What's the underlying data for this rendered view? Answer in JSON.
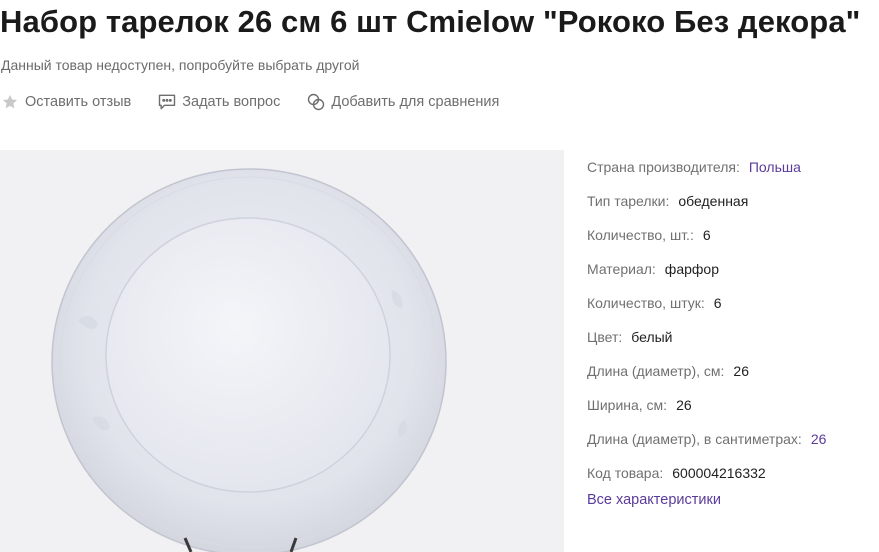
{
  "product": {
    "title": "Набор тарелок 26 см 6 шт Cmielow \"Рококо Без декора\"",
    "availability": "Данный товар недоступен, попробуйте выбрать другой"
  },
  "actions": {
    "review": {
      "label": "Оставить отзыв",
      "icon": "star-icon"
    },
    "question": {
      "label": "Задать вопрос",
      "icon": "chat-icon"
    },
    "compare": {
      "label": "Добавить для сравнения",
      "icon": "compare-icon"
    }
  },
  "specs": [
    {
      "label": "Страна производителя:",
      "value": "Польша",
      "accent": true
    },
    {
      "label": "Тип тарелки:",
      "value": "обеденная",
      "accent": false
    },
    {
      "label": "Количество, шт.:",
      "value": "6",
      "accent": false
    },
    {
      "label": "Материал:",
      "value": "фарфор",
      "accent": false
    },
    {
      "label": "Количество, штук:",
      "value": "6",
      "accent": false
    },
    {
      "label": "Цвет:",
      "value": "белый",
      "accent": false
    },
    {
      "label": "Длина (диаметр), см:",
      "value": "26",
      "accent": false
    },
    {
      "label": "Ширина, см:",
      "value": "26",
      "accent": false
    },
    {
      "label": "Длина (диаметр), в сантиметрах:",
      "value": "26",
      "accent": true
    },
    {
      "label": "Код товара:",
      "value": "600004216332",
      "accent": false
    }
  ],
  "all_specs_link": "Все характеристики",
  "colors": {
    "accent": "#5b3b9a",
    "muted": "#707070",
    "image_bg": "#f1f1f3"
  }
}
